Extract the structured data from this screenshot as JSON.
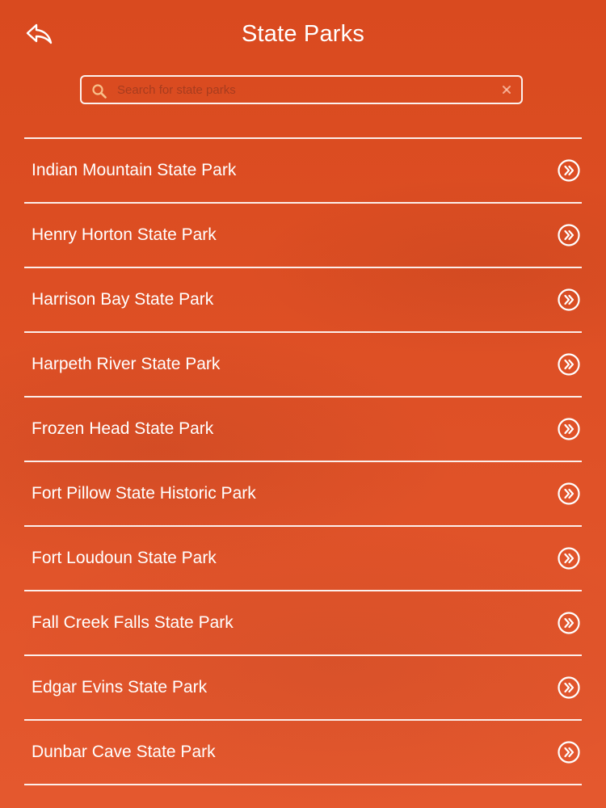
{
  "header": {
    "title": "State Parks",
    "back_icon": "back-arrow-icon"
  },
  "search": {
    "placeholder": "Search for state parks",
    "value": "",
    "search_icon": "search-icon",
    "clear_icon": "clear-icon"
  },
  "parks": [
    {
      "label": "Indian Mountain State Park",
      "icon": "circle-double-chevron-right-icon"
    },
    {
      "label": "Henry Horton State Park",
      "icon": "circle-double-chevron-right-icon"
    },
    {
      "label": "Harrison Bay State Park",
      "icon": "circle-double-chevron-right-icon"
    },
    {
      "label": "Harpeth River State Park",
      "icon": "circle-double-chevron-right-icon"
    },
    {
      "label": "Frozen Head State Park",
      "icon": "circle-double-chevron-right-icon"
    },
    {
      "label": "Fort Pillow State Historic Park",
      "icon": "circle-double-chevron-right-icon"
    },
    {
      "label": "Fort Loudoun State Park",
      "icon": "circle-double-chevron-right-icon"
    },
    {
      "label": "Fall Creek Falls State Park",
      "icon": "circle-double-chevron-right-icon"
    },
    {
      "label": "Edgar Evins State Park",
      "icon": "circle-double-chevron-right-icon"
    },
    {
      "label": "Dunbar Cave State Park",
      "icon": "circle-double-chevron-right-icon"
    }
  ],
  "colors": {
    "background": "#df5127",
    "foreground": "#ffffff"
  }
}
